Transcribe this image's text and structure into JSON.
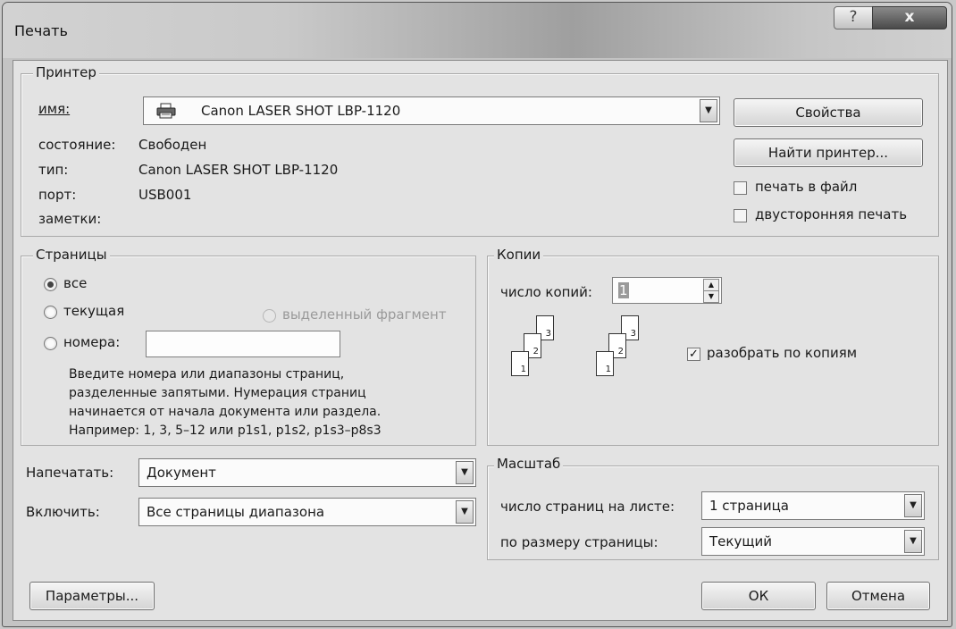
{
  "window": {
    "title": "Печать"
  },
  "printer": {
    "group_title": "Принтер",
    "name_label": "имя:",
    "name_value": "Canon LASER SHOT LBP-1120",
    "status_label": "состояние:",
    "status_value": "Свободен",
    "type_label": "тип:",
    "type_value": "Canon LASER SHOT LBP-1120",
    "port_label": "порт:",
    "port_value": "USB001",
    "notes_label": "заметки:",
    "properties_button": "Свойства",
    "find_printer_button": "Найти принтер...",
    "print_to_file_label": "печать в файл",
    "print_to_file_checked": false,
    "duplex_label": "двусторонняя печать",
    "duplex_checked": false
  },
  "pages": {
    "group_title": "Страницы",
    "all_label": "все",
    "current_label": "текущая",
    "selection_label": "выделенный фрагмент",
    "numbers_label": "номера:",
    "numbers_value": "",
    "selected_option": "все",
    "hint_line1": "Введите номера или диапазоны страниц,",
    "hint_line2": "разделенные запятыми. Нумерация страниц",
    "hint_line3": "начинается от начала документа или раздела.",
    "hint_line4": "Например: 1, 3, 5–12 или p1s1, p1s2, p1s3–p8s3"
  },
  "copies": {
    "group_title": "Копии",
    "count_label": "число копий:",
    "count_value": "1",
    "collate_label": "разобрать по копиям",
    "collate_checked": true,
    "page_numbers": [
      "1",
      "2",
      "3"
    ]
  },
  "print_what": {
    "label": "Напечатать:",
    "value": "Документ"
  },
  "include": {
    "label": "Включить:",
    "value": "Все страницы диапазона"
  },
  "zoom": {
    "group_title": "Масштаб",
    "pages_per_sheet_label": "число страниц на листе:",
    "pages_per_sheet_value": "1 страница",
    "scale_label": "по размеру страницы:",
    "scale_value": "Текущий"
  },
  "buttons": {
    "options": "Параметры...",
    "ok": "ОК",
    "cancel": "Отмена"
  },
  "titlebar_buttons": {
    "help": "?",
    "close": "x"
  }
}
